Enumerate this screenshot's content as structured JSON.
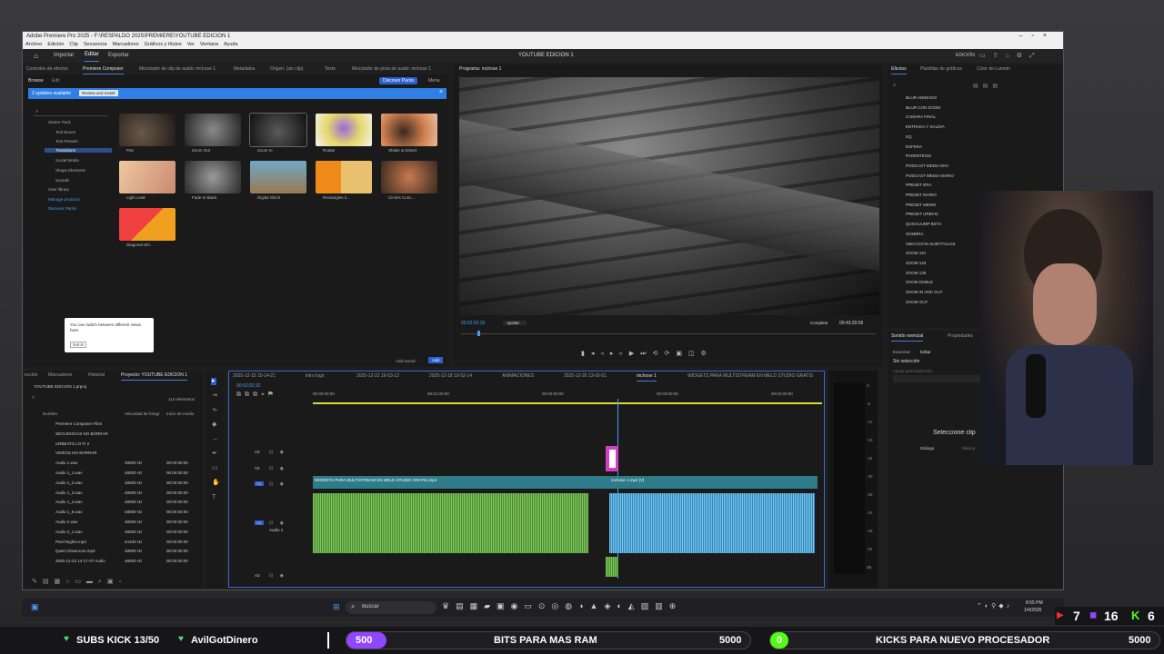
{
  "window": {
    "title": "Adobe Premiere Pro 2025 - F:\\RESPALDO 2025\\PREMIERE\\YOUTUBE EDICION 1",
    "menu": [
      "Archivo",
      "Edición",
      "Clip",
      "Secuencia",
      "Marcadores",
      "Gráficos y títulos",
      "Ver",
      "Ventana",
      "Ayuda"
    ],
    "controls": [
      "–",
      "▫",
      "×"
    ]
  },
  "workspace": {
    "tabs": [
      "Importar",
      "Editar",
      "Exportar"
    ],
    "project_name": "YOUTUBE EDICION 1",
    "right_label": "EDICIÓN"
  },
  "source_panel": {
    "tabs": [
      "Controles de efectos",
      "Premiere Composer",
      "Mezclador de clip de audio: mchose 1",
      "Metadatos",
      "Origen: (sin clip)",
      "Texto",
      "Mezclador de pista de audio: mchose 1"
    ],
    "sub_tabs": [
      "Browse",
      "Edit"
    ],
    "discover_btn": "Discover Packs",
    "menu_btn": "Menu",
    "banner": {
      "text": "2 updates available",
      "button": "Review and Install"
    },
    "tree": [
      "Starter Pack",
      "Text Boxes",
      "Text Presets",
      "Transitions",
      "Social Media",
      "Shape Elements",
      "Sounds",
      "User library",
      "Manage products",
      "Discover Packs"
    ],
    "thumbs": [
      "Pan",
      "Zoom Out",
      "Zoom In",
      "Rotate",
      "Shake & Distort",
      "Light Leak",
      "Fade to Black",
      "Digital Glitch",
      "Rectangles 2...",
      "Circles Conc...",
      "Diagonal Stri..."
    ],
    "tooltip": {
      "text": "You can switch between different views here.",
      "button": "Got it!"
    },
    "add_sound": "Add sound",
    "add_btn": "Add"
  },
  "program": {
    "tab": "Programa: mchose 1",
    "timecode": "00:02:02:32",
    "fit": "Ajustar",
    "quality": "Completa",
    "duration": "00:43:20:59"
  },
  "effects": {
    "tabs": [
      "Efectos",
      "Plantillas de gráficos",
      "Color de Lumetri"
    ],
    "items": [
      "BLUR ANIMADO",
      "BLUR CON ZOOM",
      "CAMARA FINAL",
      "ENTRADA Y SALIDA",
      "EQ",
      "ESFERA",
      "PARENTESIS",
      "PODCAST MEDIA ERA",
      "PODCAST MEDIA MARIO",
      "PRESET ERA",
      "PRESET MARIO",
      "PRESET MEMO",
      "PRESET URBVIC",
      "QUICKJUMP BETA",
      "SOMBRA",
      "UBICACION SUBTITULOS",
      "ZOOM 110",
      "ZOOM 120",
      "ZOOM 130",
      "ZOOM DOBLE",
      "ZOOM IN AND OUT",
      "ZOOM OUT"
    ]
  },
  "essential_sound": {
    "tabs": [
      "Sonido esencial",
      "Propiedades"
    ],
    "sub_tabs": [
      "Examinar",
      "Editar"
    ],
    "no_selection": "Sin selección",
    "preset_label": "Ajuste preestablecido:",
    "select_clip": "Seleccione clip",
    "dialogue": "Diálogo",
    "music": "Música"
  },
  "project": {
    "tabs": [
      "ección",
      "Marcadores",
      "Historial",
      "Proyecto: YOUTUBE EDICION 1"
    ],
    "file": "YOUTUBE EDICION 1.prproj",
    "count": "114 elementos",
    "columns": [
      "Nombre",
      "Velocidad de fotogr",
      "Inicio de medio"
    ],
    "rows": [
      [
        "Premiere Composer Files",
        "",
        ""
      ],
      [
        "SECUENCIAS NO BORRAR",
        "",
        ""
      ],
      [
        "URBEATS LO FI 2",
        "",
        ""
      ],
      [
        "VIDEOS NO BORRAR",
        "",
        ""
      ],
      [
        "Audio 1.wav",
        "48000 Hz",
        "00:00:00:00"
      ],
      [
        "Audio 1_1.wav",
        "48000 Hz",
        "00:00:00:00"
      ],
      [
        "Audio 1_2.wav",
        "48000 Hz",
        "00:00:00:00"
      ],
      [
        "Audio 1_3.wav",
        "48000 Hz",
        "00:00:00:00"
      ],
      [
        "Audio 1_4.wav",
        "48000 Hz",
        "00:00:00:00"
      ],
      [
        "Audio 1_5.wav",
        "48000 Hz",
        "00:00:00:00"
      ],
      [
        "Audio 2.wav",
        "48000 Hz",
        "00:00:00:00"
      ],
      [
        "Audio 2_1.wav",
        "48000 Hz",
        "00:00:00:00"
      ],
      [
        "Pixel Nights.mp3",
        "44100 Hz",
        "00:00:00:00"
      ],
      [
        "Quiet Classroom.mp3",
        "48000 Hz",
        "00:00:00:00"
      ],
      [
        "2025-12-22 14-17-07 Audio",
        "48000 Hz",
        "00:00:00:00"
      ]
    ]
  },
  "timeline": {
    "tabs": [
      "2025-12-15 15-14-21",
      "intro logo",
      "2025-12-22 16-53-12",
      "2025-12-18 19-52-14",
      "ANIMACIONES",
      "2025-12-26 13-00-51",
      "mchose 1",
      "WIDGETS PARA MULTISTREAM EN MELD STUDIO GRATIS"
    ],
    "timecode": "00:02:02:32",
    "ruler": [
      "00:00:00:00",
      "00:01:00:00",
      "00:02:00:00",
      "00:03:00:00",
      "00:04:00:00"
    ],
    "tracks": [
      "V3",
      "V2",
      "V1",
      "A1",
      "A2"
    ],
    "track_a1_name": "Audio 1",
    "clips": [
      "WIDGETS PARA MULTISTREAM EN MELD STUDIO GRATIS.mp4",
      "mchose 1.mp4 [V]"
    ],
    "meter": [
      "0",
      "-6",
      "-12",
      "-18",
      "-24",
      "-30",
      "-36",
      "-42",
      "-48",
      "-54",
      "dB"
    ]
  },
  "taskbar": {
    "search": "Buscar",
    "time": "8:55 PM",
    "date": "1/4/2026"
  },
  "overlay": {
    "subs": "SUBS KICK 13/50",
    "donor": "AvilGotDinero",
    "bits_num": "500",
    "bits_goal": "BITS PARA MAS RAM",
    "bits_target": "5000",
    "kicks_num": "0",
    "kicks_goal": "KICKS PARA NUEVO PROCESADOR",
    "kicks_target": "5000",
    "yt": "7",
    "twitch": "16",
    "kick": "6"
  }
}
